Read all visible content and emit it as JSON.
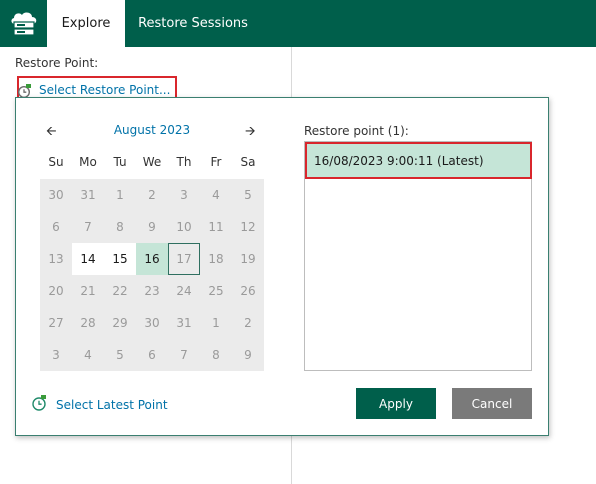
{
  "header": {
    "tabs": [
      "Explore",
      "Restore Sessions"
    ],
    "active_tab": "Explore",
    "colors": {
      "bar": "#005f4b",
      "accent_link": "#0072a8",
      "highlight": "#d9262c"
    }
  },
  "restore_point": {
    "label": "Restore Point:",
    "select_link": "Select Restore Point..."
  },
  "calendar": {
    "month": "August 2023",
    "prev_icon": "arrow-left-icon",
    "next_icon": "arrow-right-icon",
    "weekdays": [
      "Su",
      "Mo",
      "Tu",
      "We",
      "Th",
      "Fr",
      "Sa"
    ],
    "weeks": [
      [
        "30",
        "31",
        "1",
        "2",
        "3",
        "4",
        "5"
      ],
      [
        "6",
        "7",
        "8",
        "9",
        "10",
        "11",
        "12"
      ],
      [
        "13",
        "14",
        "15",
        "16",
        "17",
        "18",
        "19"
      ],
      [
        "20",
        "21",
        "22",
        "23",
        "24",
        "25",
        "26"
      ],
      [
        "27",
        "28",
        "29",
        "30",
        "31",
        "1",
        "2"
      ],
      [
        "3",
        "4",
        "5",
        "6",
        "7",
        "8",
        "9"
      ]
    ],
    "enabled_days": [
      "14",
      "15"
    ],
    "days_with_points": [
      "16"
    ],
    "today": "17"
  },
  "latest_link": "Select Latest Point",
  "restore_point_list": {
    "label": "Restore point (1):",
    "items": [
      "16/08/2023 9:00:11 (Latest)"
    ],
    "selected": "16/08/2023 9:00:11 (Latest)"
  },
  "buttons": {
    "apply": "Apply",
    "cancel": "Cancel"
  }
}
